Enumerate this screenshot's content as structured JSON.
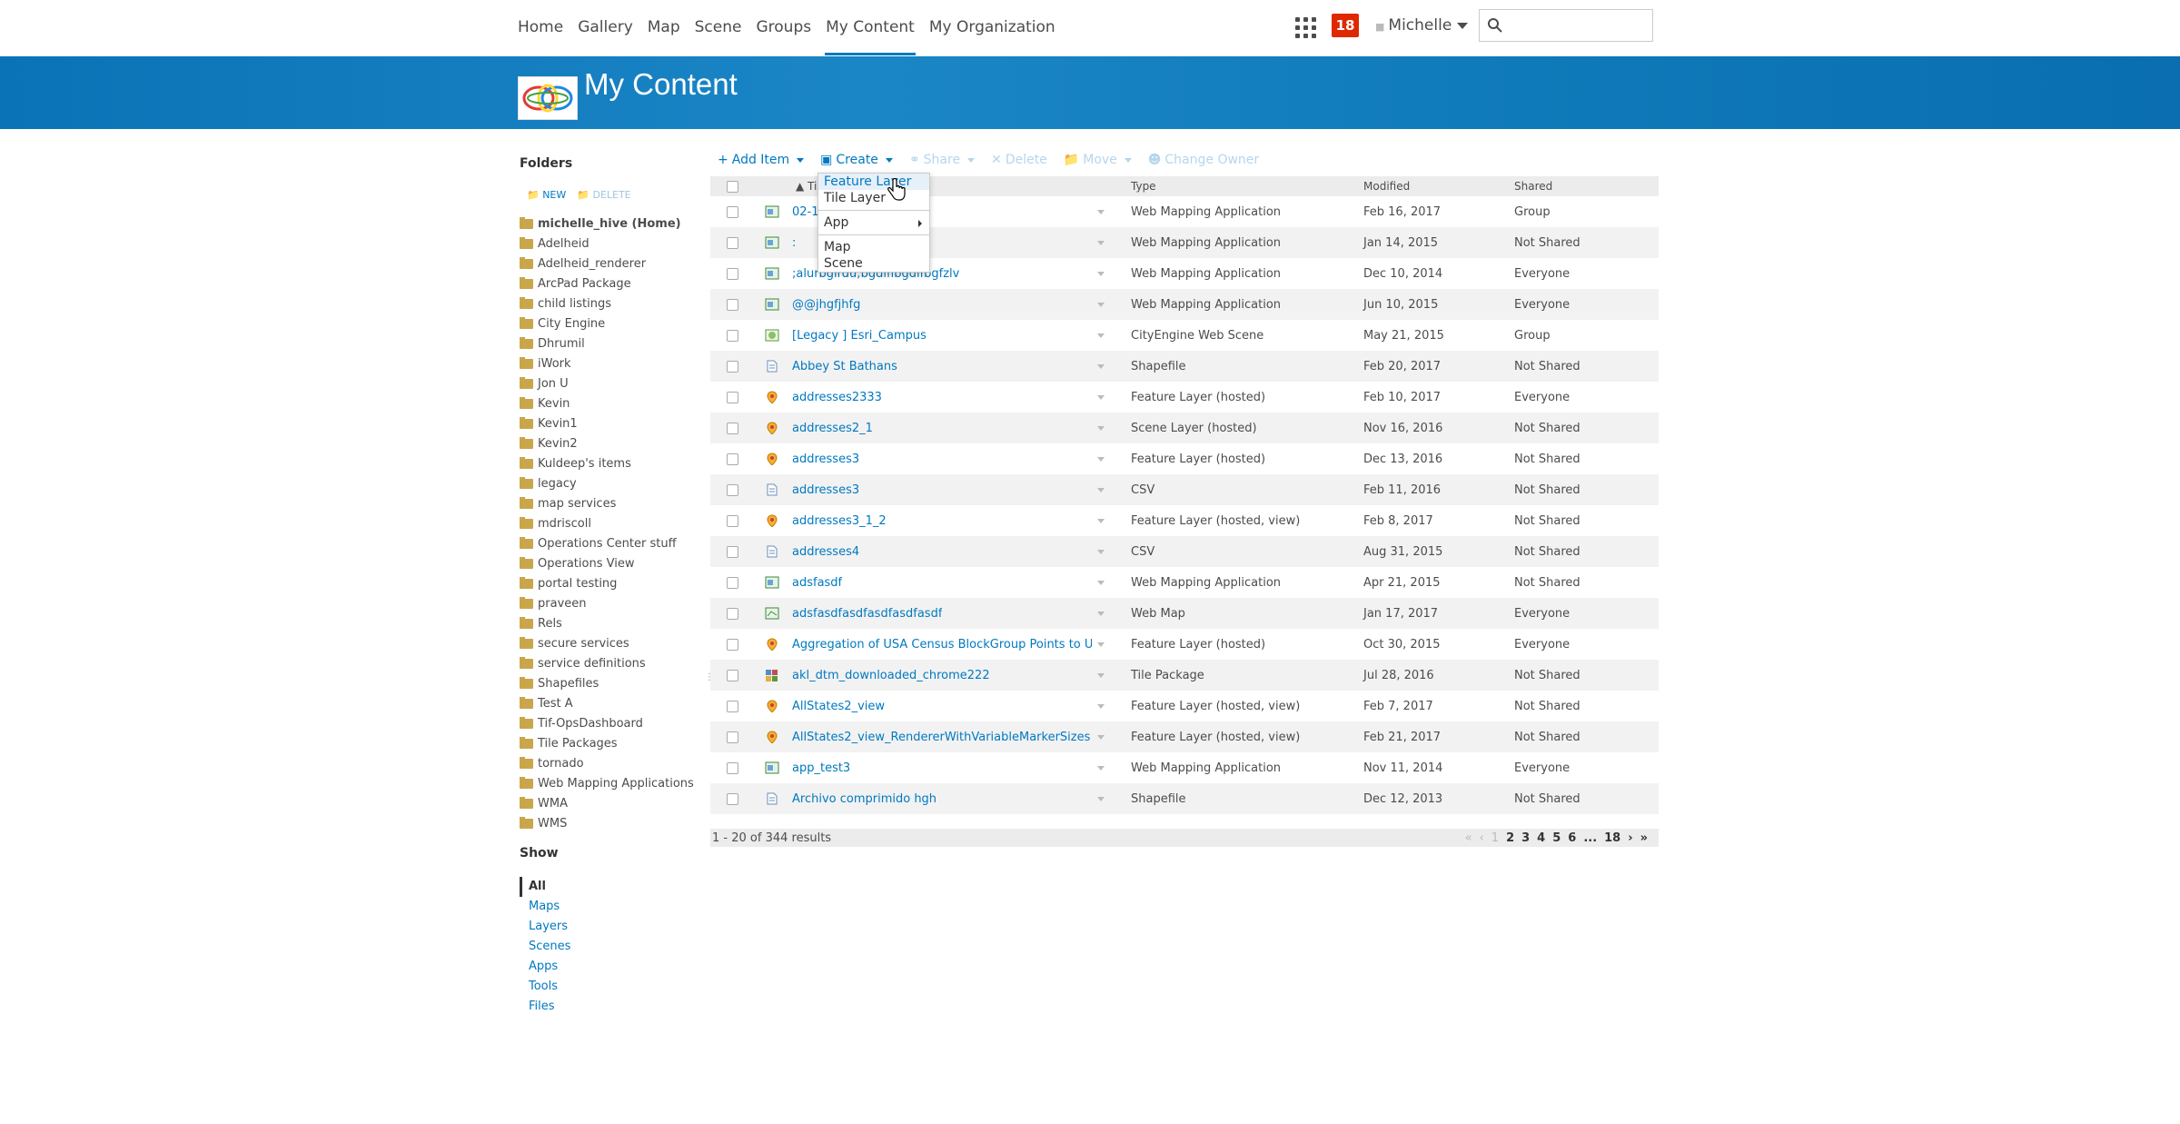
{
  "nav": {
    "links": [
      "Home",
      "Gallery",
      "Map",
      "Scene",
      "Groups",
      "My Content",
      "My Organization"
    ],
    "active_index": 5,
    "notification_count": "18",
    "user_name": "Michelle"
  },
  "banner": {
    "title": "My Content"
  },
  "sidebar": {
    "folders_heading": "Folders",
    "new_label": "NEW",
    "delete_label": "DELETE",
    "folders": [
      "michelle_hive (Home)",
      "Adelheid",
      "Adelheid_renderer",
      "ArcPad Package",
      "child listings",
      "City Engine",
      "Dhrumil",
      "iWork",
      "Jon U",
      "Kevin",
      "Kevin1",
      "Kevin2",
      "Kuldeep's items",
      "legacy",
      "map services",
      "mdriscoll",
      "Operations Center stuff",
      "Operations View",
      "portal testing",
      "praveen",
      "Rels",
      "secure services",
      "service definitions",
      "Shapefiles",
      "Test A",
      "Tif-OpsDashboard",
      "Tile Packages",
      "tornado",
      "Web Mapping Applications",
      "WMA",
      "WMS"
    ],
    "show_heading": "Show",
    "show_items": [
      "All",
      "Maps",
      "Layers",
      "Scenes",
      "Apps",
      "Tools",
      "Files"
    ]
  },
  "toolbar": {
    "add_item": "Add Item",
    "create": "Create",
    "share": "Share",
    "delete": "Delete",
    "move": "Move",
    "change_owner": "Change Owner"
  },
  "create_menu": {
    "items": [
      "Feature Layer",
      "Tile Layer",
      "App",
      "Map",
      "Scene"
    ]
  },
  "table": {
    "columns": {
      "title": "Ti",
      "type": "Type",
      "modified": "Modified",
      "shared": "Shared"
    },
    "rows": [
      {
        "title": "02-1",
        "type": "Web Mapping Application",
        "modified": "Feb 16, 2017",
        "shared": "Group",
        "icon": "app"
      },
      {
        "title": ":",
        "type": "Web Mapping Application",
        "modified": "Jan 14, 2015",
        "shared": "Not Shared",
        "icon": "app"
      },
      {
        "title": ";alurbgirdu;bgdlfibgdlfbgfzlv",
        "type": "Web Mapping Application",
        "modified": "Dec 10, 2014",
        "shared": "Everyone",
        "icon": "app"
      },
      {
        "title": "@@jhgfjhfg",
        "type": "Web Mapping Application",
        "modified": "Jun 10, 2015",
        "shared": "Everyone",
        "icon": "app"
      },
      {
        "title": "[Legacy ] Esri_Campus",
        "type": "CityEngine Web Scene",
        "modified": "May 21, 2015",
        "shared": "Group",
        "icon": "scene"
      },
      {
        "title": "Abbey St Bathans",
        "type": "Shapefile",
        "modified": "Feb 20, 2017",
        "shared": "Not Shared",
        "icon": "file"
      },
      {
        "title": "addresses2333",
        "type": "Feature Layer (hosted)",
        "modified": "Feb 10, 2017",
        "shared": "Everyone",
        "icon": "layer"
      },
      {
        "title": "addresses2_1",
        "type": "Scene Layer (hosted)",
        "modified": "Nov 16, 2016",
        "shared": "Not Shared",
        "icon": "layer"
      },
      {
        "title": "addresses3",
        "type": "Feature Layer (hosted)",
        "modified": "Dec 13, 2016",
        "shared": "Not Shared",
        "icon": "layer"
      },
      {
        "title": "addresses3",
        "type": "CSV",
        "modified": "Feb 11, 2016",
        "shared": "Not Shared",
        "icon": "file"
      },
      {
        "title": "addresses3_1_2",
        "type": "Feature Layer (hosted, view)",
        "modified": "Feb 8, 2017",
        "shared": "Not Shared",
        "icon": "layer"
      },
      {
        "title": "addresses4",
        "type": "CSV",
        "modified": "Aug 31, 2015",
        "shared": "Not Shared",
        "icon": "file"
      },
      {
        "title": "adsfasdf",
        "type": "Web Mapping Application",
        "modified": "Apr 21, 2015",
        "shared": "Not Shared",
        "icon": "app"
      },
      {
        "title": "adsfasdfasdfasdfasdfasdf",
        "type": "Web Map",
        "modified": "Jan 17, 2017",
        "shared": "Everyone",
        "icon": "map"
      },
      {
        "title": "Aggregation of USA Census BlockGroup Points to US...",
        "type": "Feature Layer (hosted)",
        "modified": "Oct 30, 2015",
        "shared": "Everyone",
        "icon": "layer"
      },
      {
        "title": "akl_dtm_downloaded_chrome222",
        "type": "Tile Package",
        "modified": "Jul 28, 2016",
        "shared": "Not Shared",
        "icon": "tile"
      },
      {
        "title": "AllStates2_view",
        "type": "Feature Layer (hosted, view)",
        "modified": "Feb 7, 2017",
        "shared": "Not Shared",
        "icon": "layer"
      },
      {
        "title": "AllStates2_view_RendererWithVariableMarkerSizes",
        "type": "Feature Layer (hosted, view)",
        "modified": "Feb 21, 2017",
        "shared": "Not Shared",
        "icon": "layer"
      },
      {
        "title": "app_test3",
        "type": "Web Mapping Application",
        "modified": "Nov 11, 2014",
        "shared": "Everyone",
        "icon": "app"
      },
      {
        "title": "Archivo comprimido hgh",
        "type": "Shapefile",
        "modified": "Dec 12, 2013",
        "shared": "Not Shared",
        "icon": "file"
      }
    ]
  },
  "pager": {
    "results_text": "1 - 20 of 344 results",
    "pages": [
      "1",
      "2",
      "3",
      "4",
      "5",
      "6",
      "...",
      "18"
    ]
  }
}
